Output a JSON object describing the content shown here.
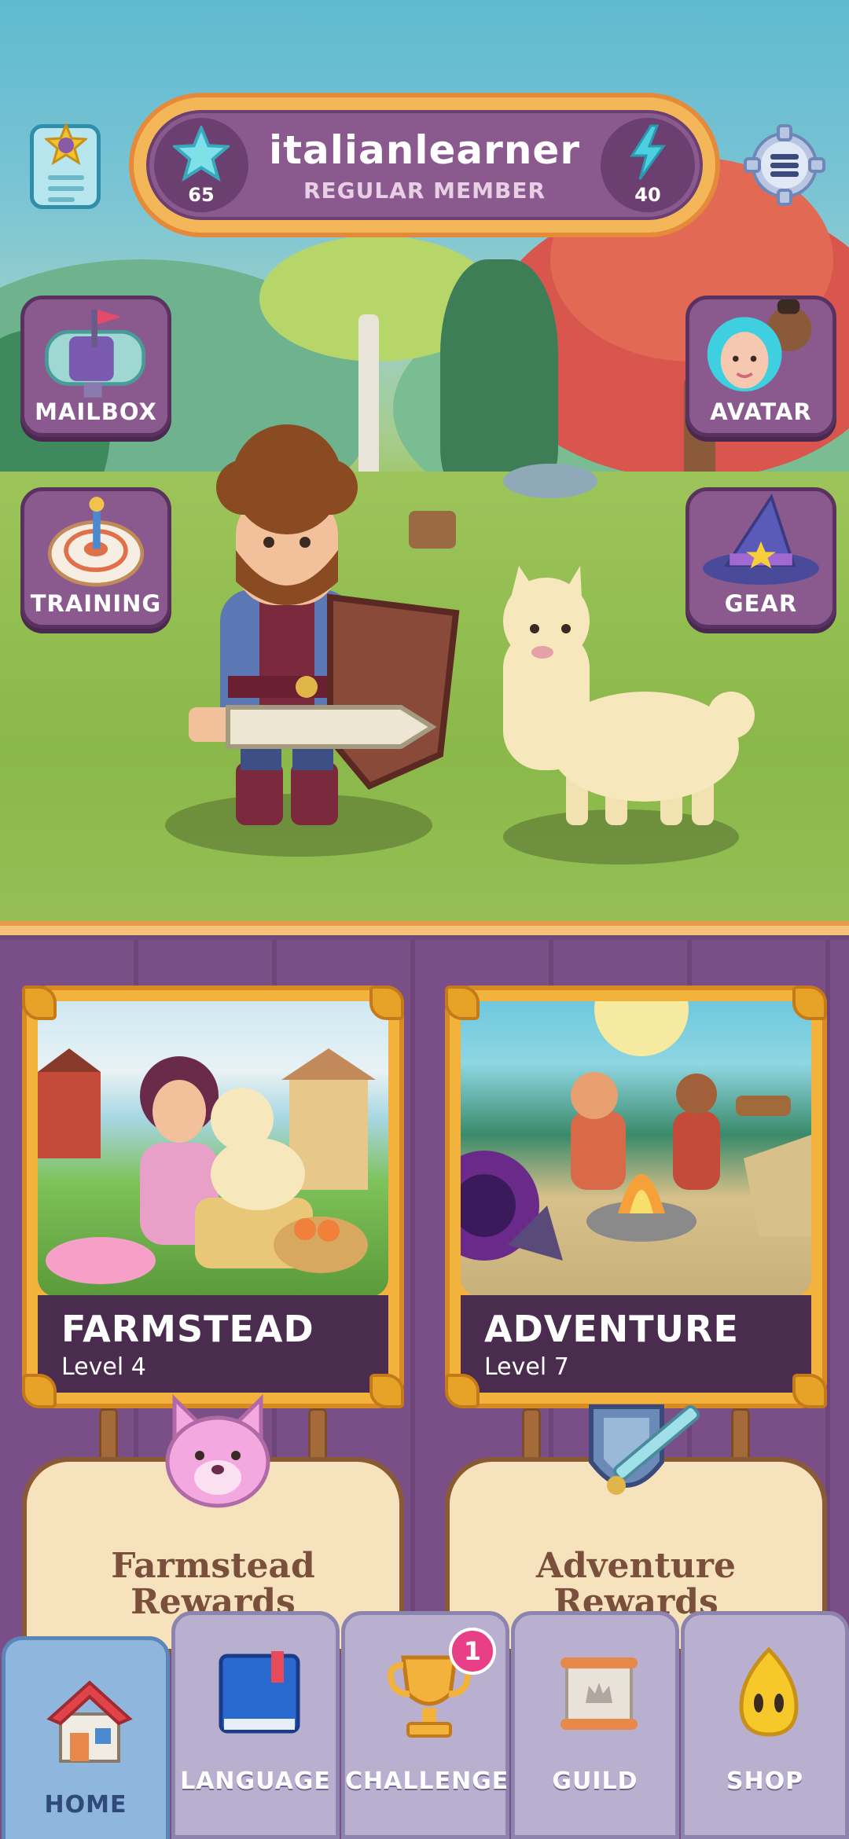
{
  "header": {
    "username": "italianlearner",
    "membership": "REGULAR MEMBER",
    "stars": "65",
    "energy": "40"
  },
  "side_buttons": {
    "mailbox": "MAILBOX",
    "training": "TRAINING",
    "avatar": "AVATAR",
    "gear": "GEAR"
  },
  "cards": [
    {
      "title": "FARMSTEAD",
      "level": "Level 4"
    },
    {
      "title": "ADVENTURE",
      "level": "Level 7"
    }
  ],
  "rewards": [
    {
      "line1": "Farmstead",
      "line2": "Rewards"
    },
    {
      "line1": "Adventure",
      "line2": "Rewards"
    }
  ],
  "nav": {
    "home": "HOME",
    "language": "LANGUAGE",
    "challenge": "CHALLENGE",
    "challenge_badge": "1",
    "guild": "GUILD",
    "shop": "SHOP"
  },
  "colors": {
    "accent_orange": "#f3b75a",
    "panel_purple": "#8a5a8e",
    "badge_pink": "#e93f86",
    "nav_active_blue": "#8fb6dc"
  },
  "icons": [
    "profile-card-icon",
    "star-icon",
    "lightning-icon",
    "settings-icon",
    "mailbox-icon",
    "target-icon",
    "avatar-icon",
    "wizard-hat-icon",
    "house-icon",
    "book-icon",
    "trophy-icon",
    "scroll-icon",
    "flame-icon"
  ]
}
